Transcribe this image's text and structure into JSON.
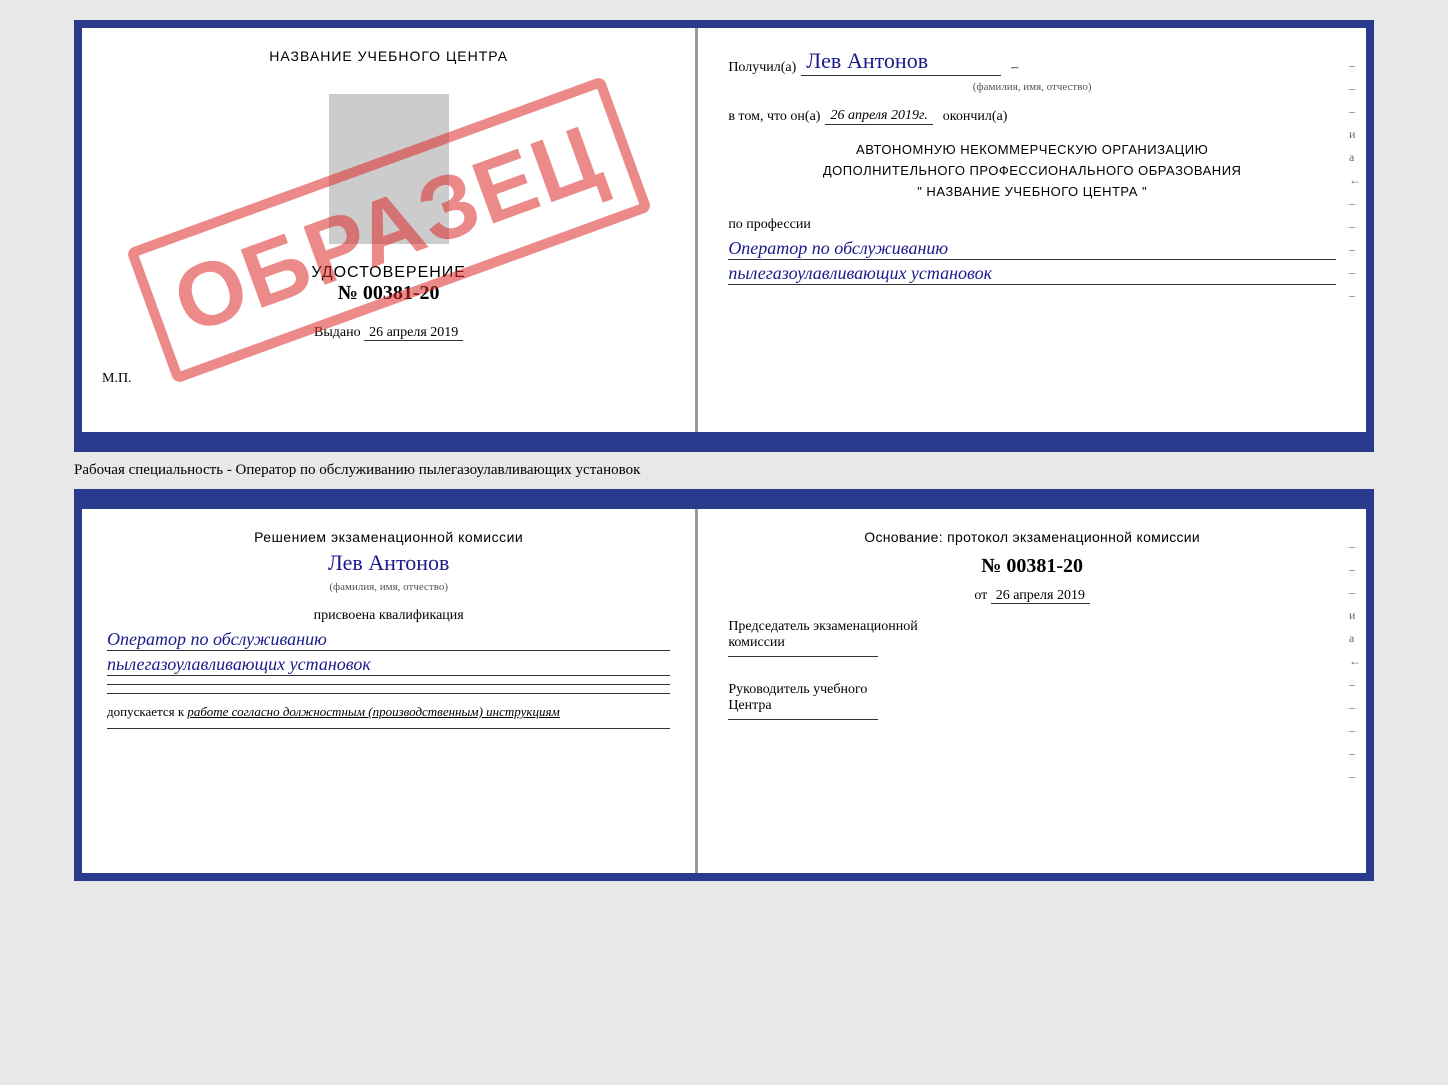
{
  "top_cert": {
    "left": {
      "title": "НАЗВАНИЕ УЧЕБНОГО ЦЕНТРА",
      "stamp": "ОБРАЗЕЦ",
      "udostoverenie_label": "УДОСТОВЕРЕНИЕ",
      "number": "№ 00381-20",
      "vydano_label": "Выдано",
      "vydano_date": "26 апреля 2019",
      "mp": "М.П."
    },
    "right": {
      "poluchil_label": "Получил(а)",
      "name": "Лев Антонов",
      "fio_label": "(фамилия, имя, отчество)",
      "v_tom_chto": "в том, что он(а)",
      "date": "26 апреля 2019г.",
      "okonchil_label": "окончил(а)",
      "org_line1": "АВТОНОМНУЮ НЕКОММЕРЧЕСКУЮ ОРГАНИЗАЦИЮ",
      "org_line2": "ДОПОЛНИТЕЛЬНОГО ПРОФЕССИОНАЛЬНОГО ОБРАЗОВАНИЯ",
      "org_line3": "\"    НАЗВАНИЕ УЧЕБНОГО ЦЕНТРА    \"",
      "po_professii": "по профессии",
      "profession_line1": "Оператор по обслуживанию",
      "profession_line2": "пылегазоулавливающих установок"
    }
  },
  "middle_text": "Рабочая специальность - Оператор по обслуживанию пылегазоулавливающих установок",
  "bottom_cert": {
    "left": {
      "resheniem": "Решением экзаменационной комиссии",
      "name": "Лев Антонов",
      "fio_label": "(фамилия, имя, отчество)",
      "prisvoena": "присвоена квалификация",
      "kvali_line1": "Оператор по обслуживанию",
      "kvali_line2": "пылегазоулавливающих установок",
      "dopuskaetsya": "допускается к",
      "work_text": "работе согласно должностным (производственным) инструкциям"
    },
    "right": {
      "osnovanie": "Основание: протокол экзаменационной комиссии",
      "number": "№  00381-20",
      "ot_label": "от",
      "ot_date": "26 апреля 2019",
      "predsedatel_line1": "Председатель экзаменационной",
      "predsedatel_line2": "комиссии",
      "rukovoditel_line1": "Руководитель учебного",
      "rukovoditel_line2": "Центра"
    }
  },
  "side_marks": {
    "items": [
      "–",
      "–",
      "–",
      "и",
      "а",
      "←",
      "–",
      "–",
      "–",
      "–"
    ]
  }
}
